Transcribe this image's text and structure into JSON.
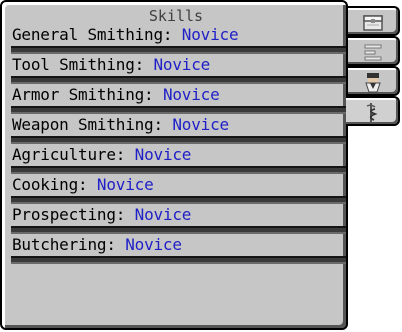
{
  "panel": {
    "title": "Skills"
  },
  "skills": [
    {
      "name": "General Smithing: ",
      "level": "Novice",
      "progress": 0
    },
    {
      "name": "Tool Smithing: ",
      "level": "Novice",
      "progress": 0
    },
    {
      "name": "Armor Smithing: ",
      "level": "Novice",
      "progress": 0
    },
    {
      "name": "Weapon Smithing: ",
      "level": "Novice",
      "progress": 0
    },
    {
      "name": "Agriculture: ",
      "level": "Novice",
      "progress": 0
    },
    {
      "name": "Cooking: ",
      "level": "Novice",
      "progress": 0
    },
    {
      "name": "Prospecting: ",
      "level": "Novice",
      "progress": 0
    },
    {
      "name": "Butchering: ",
      "level": "Novice",
      "progress": 0
    }
  ],
  "tabs": [
    {
      "icon": "chest-icon",
      "active": false
    },
    {
      "icon": "list-icon",
      "active": false
    },
    {
      "icon": "player-icon",
      "active": false
    },
    {
      "icon": "caduceus-icon",
      "active": true
    }
  ],
  "colors": {
    "panel": "#c6c6c6",
    "skill_level": "#1f1fc8",
    "bar": "#3a3a3a"
  }
}
